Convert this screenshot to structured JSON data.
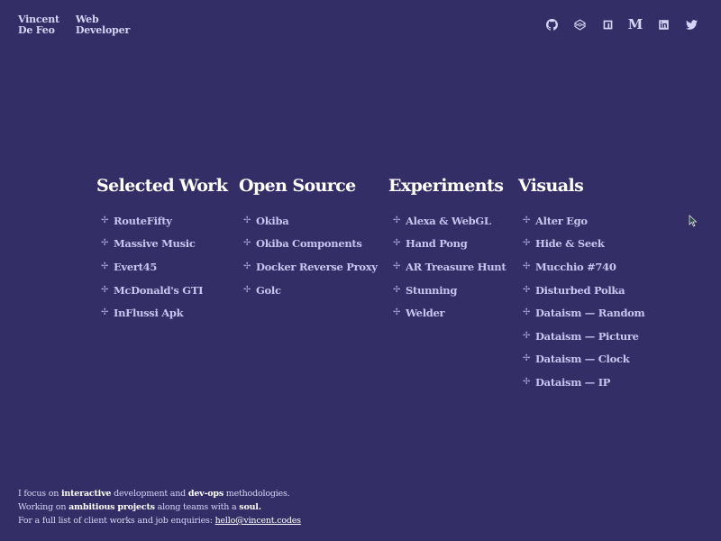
{
  "brand": {
    "name_line1": "Vincent",
    "name_line2": "De Feo",
    "role_line1": "Web",
    "role_line2": "Developer"
  },
  "socials": [
    {
      "name": "github",
      "icon": "github-icon"
    },
    {
      "name": "codepen",
      "icon": "codepen-icon"
    },
    {
      "name": "npm",
      "icon": "npm-icon"
    },
    {
      "name": "medium",
      "icon": "medium-icon",
      "glyph": "M"
    },
    {
      "name": "linkedin",
      "icon": "linkedin-icon"
    },
    {
      "name": "twitter",
      "icon": "twitter-icon"
    }
  ],
  "sections": [
    {
      "title": "Selected Work",
      "items": [
        "RouteFifty",
        "Massive Music",
        "Evert45",
        "McDonald's GTI",
        "InFlussi Apk"
      ]
    },
    {
      "title": "Open Source",
      "items": [
        "Okiba",
        "Okiba Components",
        "Docker Reverse Proxy",
        "Golc"
      ]
    },
    {
      "title": "Experiments",
      "items": [
        "Alexa & WebGL",
        "Hand Pong",
        "AR Treasure Hunt",
        "Stunning",
        "Welder"
      ]
    },
    {
      "title": "Visuals",
      "items": [
        "Alter Ego",
        "Hide & Seek",
        "Mucchio #740",
        "Disturbed Polka",
        "Dataism — Random",
        "Dataism — Picture",
        "Dataism — Clock",
        "Dataism — IP"
      ]
    }
  ],
  "bullet_glyph": "✢",
  "footer": {
    "line1_a": "I focus on ",
    "line1_b": "interactive",
    "line1_c": " development and ",
    "line1_d": "dev-ops",
    "line1_e": " methodologies.",
    "line2_a": "Working on ",
    "line2_b": "ambitious projects",
    "line2_c": " along teams with a ",
    "line2_d": "soul.",
    "line3_a": "For a full list of client works and job enquiries: ",
    "line3_link": "hello@vincent.codes"
  },
  "colors": {
    "background": "#332f66",
    "heading": "#ffffff",
    "link": "#c7c4f0"
  }
}
